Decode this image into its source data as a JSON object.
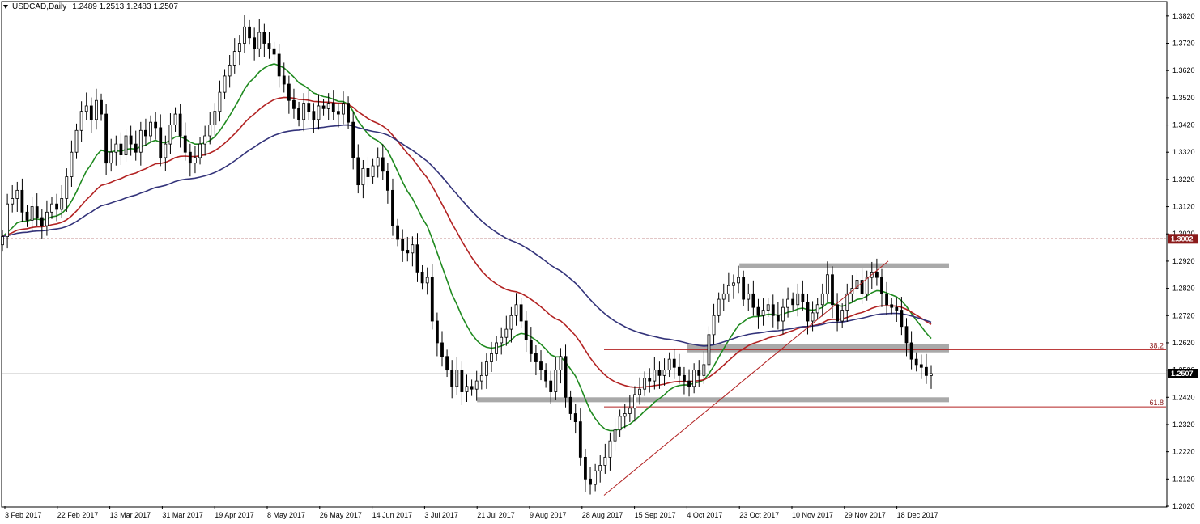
{
  "header": {
    "symbol": "USDCAD,Daily",
    "ohlc": "1.2489 1.2513 1.2483 1.2507"
  },
  "colors": {
    "candle": "#000000",
    "ma_fast": "#1f8a1f",
    "ma_mid": "#b22222",
    "ma_slow": "#33337a",
    "zone": "#a9a9a9",
    "fib": "#b22222",
    "level": "#8b1a1a"
  },
  "chart_data": {
    "type": "candlestick",
    "title": "USDCAD,Daily",
    "ylim": [
      1.202,
      1.387
    ],
    "y_ticks": [
      "1.3820",
      "1.3720",
      "1.3620",
      "1.3520",
      "1.3420",
      "1.3320",
      "1.3220",
      "1.3120",
      "1.3020",
      "1.2920",
      "1.2820",
      "1.2720",
      "1.2620",
      "1.2520",
      "1.2420",
      "1.2320",
      "1.2220",
      "1.2120",
      "1.2020"
    ],
    "x_ticks": [
      "3 Feb 2017",
      "22 Feb 2017",
      "13 Mar 2017",
      "31 Mar 2017",
      "19 Apr 2017",
      "8 May 2017",
      "26 May 2017",
      "14 Jun 2017",
      "3 Jul 2017",
      "21 Jul 2017",
      "9 Aug 2017",
      "28 Aug 2017",
      "15 Sep 2017",
      "4 Oct 2017",
      "23 Oct 2017",
      "10 Nov 2017",
      "29 Nov 2017",
      "18 Dec 2017"
    ],
    "closes": [
      1.301,
      1.313,
      1.315,
      1.318,
      1.31,
      1.307,
      1.312,
      1.308,
      1.305,
      1.31,
      1.313,
      1.311,
      1.315,
      1.323,
      1.332,
      1.34,
      1.347,
      1.349,
      1.344,
      1.351,
      1.346,
      1.328,
      1.332,
      1.335,
      1.331,
      1.338,
      1.335,
      1.332,
      1.34,
      1.338,
      1.343,
      1.341,
      1.33,
      1.335,
      1.342,
      1.346,
      1.338,
      1.332,
      1.328,
      1.33,
      1.335,
      1.338,
      1.342,
      1.347,
      1.354,
      1.36,
      1.364,
      1.369,
      1.372,
      1.378,
      1.374,
      1.37,
      1.376,
      1.372,
      1.37,
      1.368,
      1.36,
      1.357,
      1.351,
      1.348,
      1.344,
      1.35,
      1.347,
      1.344,
      1.349,
      1.348,
      1.35,
      1.347,
      1.346,
      1.35,
      1.343,
      1.33,
      1.32,
      1.326,
      1.323,
      1.327,
      1.33,
      1.325,
      1.318,
      1.305,
      1.3,
      1.296,
      1.295,
      1.298,
      1.288,
      1.284,
      1.286,
      1.27,
      1.262,
      1.257,
      1.252,
      1.246,
      1.252,
      1.244,
      1.246,
      1.245,
      1.248,
      1.25,
      1.255,
      1.258,
      1.262,
      1.264,
      1.267,
      1.272,
      1.276,
      1.27,
      1.263,
      1.258,
      1.255,
      1.252,
      1.248,
      1.244,
      1.252,
      1.257,
      1.242,
      1.236,
      1.233,
      1.22,
      1.212,
      1.21,
      1.215,
      1.217,
      1.22,
      1.226,
      1.23,
      1.235,
      1.236,
      1.238,
      1.243,
      1.245,
      1.249,
      1.248,
      1.252,
      1.25,
      1.252,
      1.256,
      1.253,
      1.25,
      1.248,
      1.246,
      1.252,
      1.25,
      1.254,
      1.265,
      1.272,
      1.278,
      1.28,
      1.283,
      1.284,
      1.286,
      1.278,
      1.28,
      1.275,
      1.272,
      1.274,
      1.276,
      1.272,
      1.27,
      1.275,
      1.278,
      1.276,
      1.28,
      1.277,
      1.27,
      1.273,
      1.276,
      1.28,
      1.287,
      1.276,
      1.27,
      1.274,
      1.28,
      1.282,
      1.285,
      1.28,
      1.286,
      1.288,
      1.286,
      1.28,
      1.276,
      1.275,
      1.274,
      1.268,
      1.262,
      1.256,
      1.254,
      1.253,
      1.25,
      1.2507
    ],
    "horizontal_line": {
      "value": 1.3002,
      "label": "1.3002",
      "style": "dashed"
    },
    "current_price": {
      "value": 1.2507,
      "label": "1.2507"
    },
    "fib_levels": [
      {
        "label": "38.2",
        "value": 1.2595
      },
      {
        "label": "61.8",
        "value": 1.2385
      }
    ],
    "zones": [
      {
        "from_date": "23 Oct 2017",
        "to_date": "end",
        "top": 1.2912,
        "bottom": 1.2895
      },
      {
        "from_date": "4 Oct 2017",
        "to_date": "end",
        "top": 1.2615,
        "bottom": 1.2585
      },
      {
        "from_date": "21 Jul 2017",
        "to_date": "end",
        "top": 1.242,
        "bottom": 1.2402
      }
    ],
    "trendline": {
      "from": {
        "date": "6 Sep 2017",
        "value": 1.206
      },
      "to": {
        "date": "14 Dec 2017",
        "value": 1.292
      }
    },
    "moving_averages": [
      {
        "color": "ma_fast"
      },
      {
        "color": "ma_mid"
      },
      {
        "color": "ma_slow"
      }
    ]
  }
}
